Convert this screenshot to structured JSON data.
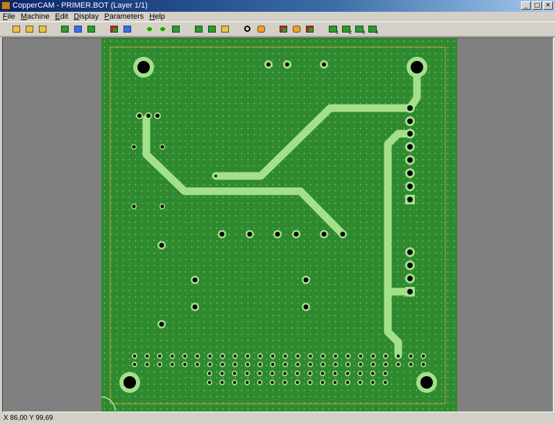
{
  "window": {
    "title": "CopperCAM  -  PRIMER.BOT  (Layer 1/1)",
    "controls": [
      "_",
      "□",
      "✕"
    ]
  },
  "menu": [
    "File",
    "Machine",
    "Edit",
    "Display",
    "Parameters",
    "Help"
  ],
  "toolbar_icons": [
    "open-file-icon",
    "open-gerber-icon",
    "open-drill-icon",
    "board-outline-icon",
    "contour-icon",
    "pad-shapes-icon",
    "select-pad-icon",
    "select-track-icon",
    "drill-hole-icon",
    "drill-center-icon",
    "drill-options-icon",
    "calculate-contours-icon",
    "mill-icon",
    "export-icon",
    "zoom-icon",
    "probe-icon",
    "track-red-icon",
    "track-orange-icon",
    "track-brown-icon",
    "layer-1-icon",
    "layer-2-icon",
    "layer-3-icon",
    "layer-4-icon"
  ],
  "layer_numbers": [
    "1",
    "2",
    "3",
    "4"
  ],
  "status": {
    "coordinates": "X 86,00   Y 99,69"
  },
  "colors": {
    "board": "#2f8a2f",
    "track": "#a4e08a",
    "outline": "#c8a04a",
    "hole": "#000000"
  }
}
